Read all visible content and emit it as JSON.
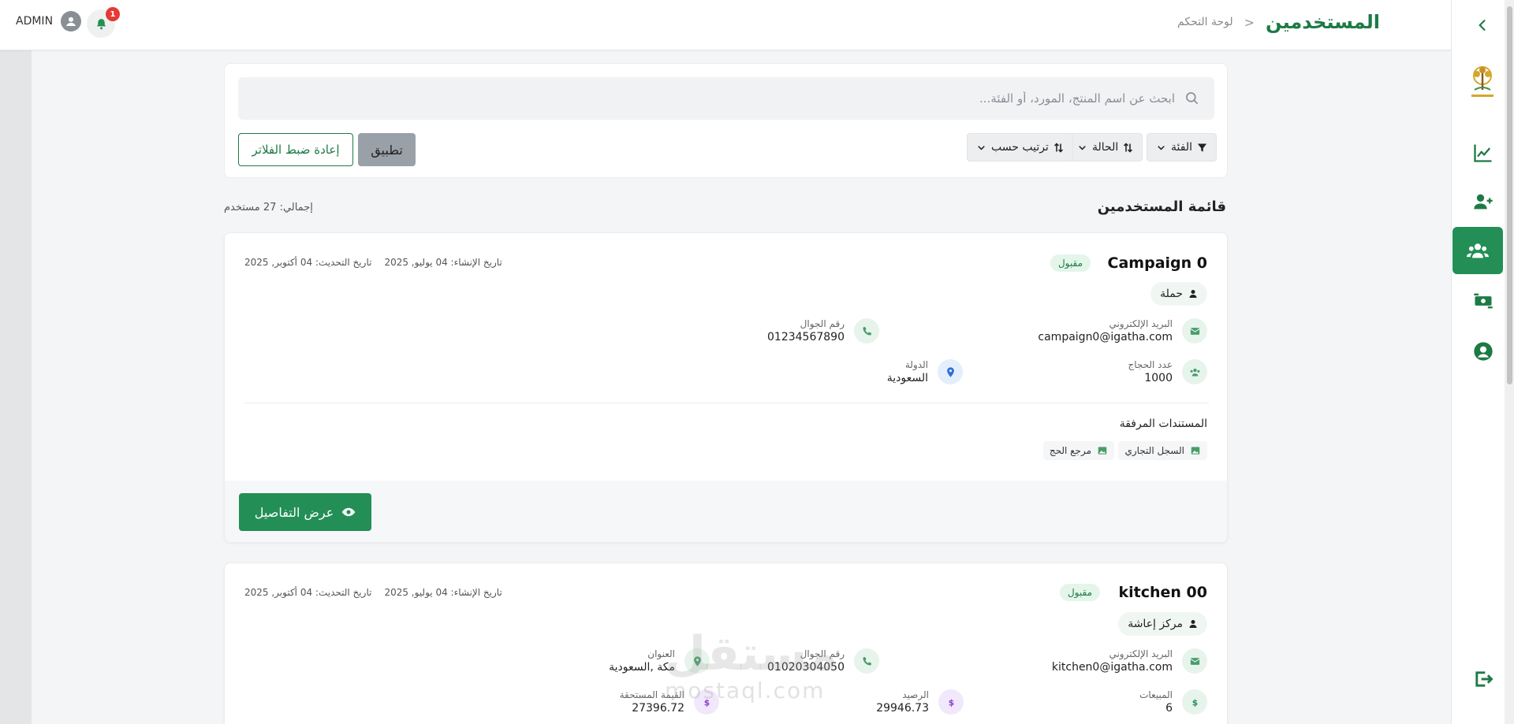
{
  "header": {
    "admin_label": "ADMIN",
    "notification_count": "1",
    "page_title": "المستخدمين",
    "breadcrumb_parent": "لوحة التحكم",
    "breadcrumb_sep": "<"
  },
  "sidebar": {
    "items": [
      {
        "icon": "chart-line-icon"
      },
      {
        "icon": "user-plus-icon"
      },
      {
        "icon": "users-icon",
        "active": true
      },
      {
        "icon": "money-exchange-icon"
      },
      {
        "icon": "user-circle-icon"
      },
      {
        "icon": "logout-icon"
      }
    ]
  },
  "filters": {
    "search_placeholder": "ابحث عن اسم المنتج، المورد، أو الفئة...",
    "category_label": "الفئة",
    "status_label": "الحالة",
    "sort_label": "ترتيب حسب",
    "apply_label": "تطبيق",
    "reset_label": "إعادة ضبط الفلاتر"
  },
  "list": {
    "title": "قائمة المستخدمين",
    "total": "إجمالي: 27 مستخدم"
  },
  "users": [
    {
      "name": "Campaign 0",
      "status": "مقبول",
      "created": "تاريخ الإنشاء: 04 يوليو, 2025",
      "updated": "تاريخ التحديث: 04 أكتوبر, 2025",
      "type": "حملة",
      "fields": {
        "email_label": "البريد الإلكتروني",
        "email_value": "campaign0@igatha.com",
        "phone_label": "رقم الجوال",
        "phone_value": "01234567890",
        "pilgrims_label": "عدد الحجاج",
        "pilgrims_value": "1000",
        "country_label": "الدولة",
        "country_value": "السعودية"
      },
      "docs_title": "المستندات المرفقة",
      "docs": [
        "السجل التجاري",
        "مرجع الحج"
      ],
      "details_label": "عرض التفاصيل"
    },
    {
      "name": "kitchen 00",
      "status": "مقبول",
      "created": "تاريخ الإنشاء: 04 يوليو, 2025",
      "updated": "تاريخ التحديث: 04 أكتوبر, 2025",
      "type": "مركز إعاشة",
      "fields": {
        "email_label": "البريد الإلكتروني",
        "email_value": "kitchen0@igatha.com",
        "phone_label": "رقم الجوال",
        "phone_value": "01020304050",
        "address_label": "العنوان",
        "address_value": "مكة ,السعودية",
        "sales_label": "المبيعات",
        "sales_value": "6",
        "balance_label": "الرصيد",
        "balance_value": "29946.73",
        "due_label": "القيمة المستحقة",
        "due_value": "27396.72"
      }
    }
  ],
  "watermark": {
    "text": "مستقل",
    "sub": "mostaql.com"
  },
  "colors": {
    "primary": "#238f56",
    "title": "#1e7a45",
    "badge": "#e53935"
  }
}
